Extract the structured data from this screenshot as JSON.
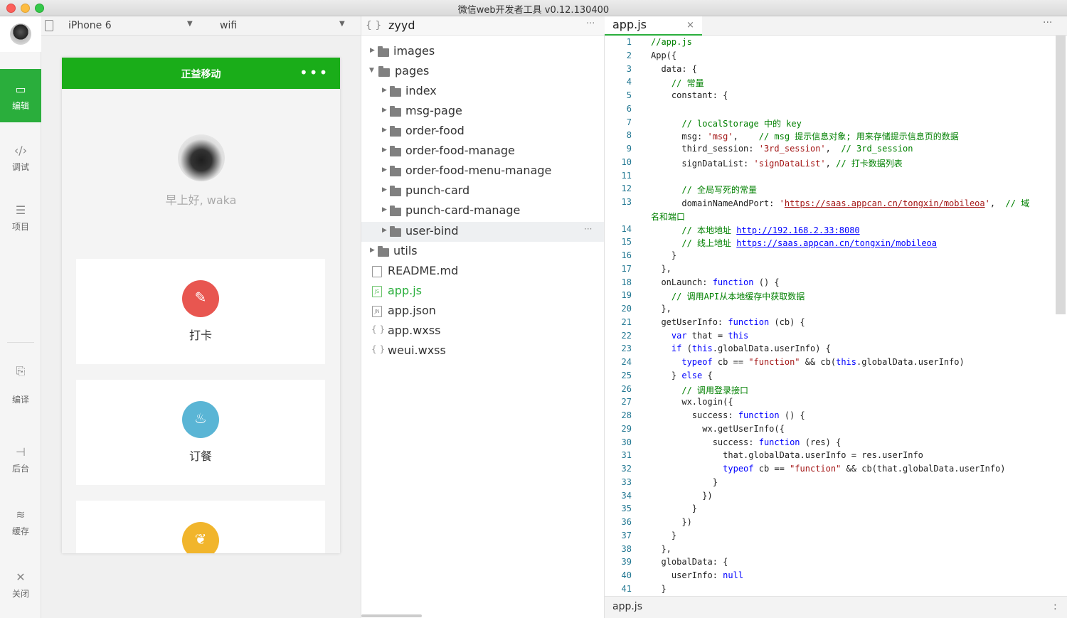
{
  "window": {
    "title": "微信web开发者工具 v0.12.130400"
  },
  "sidebar": {
    "items": [
      {
        "label": "编辑",
        "icon": "code-icon"
      },
      {
        "label": "调试",
        "icon": "debug-icon"
      },
      {
        "label": "项目",
        "icon": "menu-icon"
      },
      {
        "label": "编译",
        "icon": "compile-icon"
      },
      {
        "label": "后台",
        "icon": "backend-icon"
      },
      {
        "label": "缓存",
        "icon": "layers-icon"
      },
      {
        "label": "关闭",
        "icon": "close-icon"
      }
    ],
    "glyphs": {
      "edit": "▭",
      "debug": "‹/›",
      "project": "☰",
      "compile": "⎘",
      "backend": "⊣",
      "cache": "≋",
      "close": "✕"
    }
  },
  "device": {
    "label": "iPhone 6",
    "network": "wifi",
    "caret": "▼"
  },
  "simulator": {
    "nav_title": "正益移动",
    "nav_dots": "•••",
    "greeting": "早上好, waka",
    "cards": [
      {
        "label": "打卡",
        "glyph": "✎"
      },
      {
        "label": "订餐",
        "glyph": "♨"
      },
      {
        "label": "",
        "glyph": "❦"
      }
    ]
  },
  "file_tree": {
    "project": "zyyd",
    "more": "···",
    "items": [
      "images",
      "pages",
      "index",
      "msg-page",
      "order-food",
      "order-food-manage",
      "order-food-menu-manage",
      "punch-card",
      "punch-card-manage",
      "user-bind",
      "utils",
      "README.md",
      "app.js",
      "app.json",
      "app.wxss",
      "weui.wxss"
    ],
    "selected": "user-bind",
    "carets": {
      "closed": "▶",
      "open": "▼"
    },
    "icon_text": {
      "js": "JS",
      "json": "JN",
      "wxss": "{ }"
    }
  },
  "editor": {
    "tab_label": "app.js",
    "tab_close": "×",
    "more": "···",
    "status_file": "app.js",
    "status_more": ":"
  }
}
